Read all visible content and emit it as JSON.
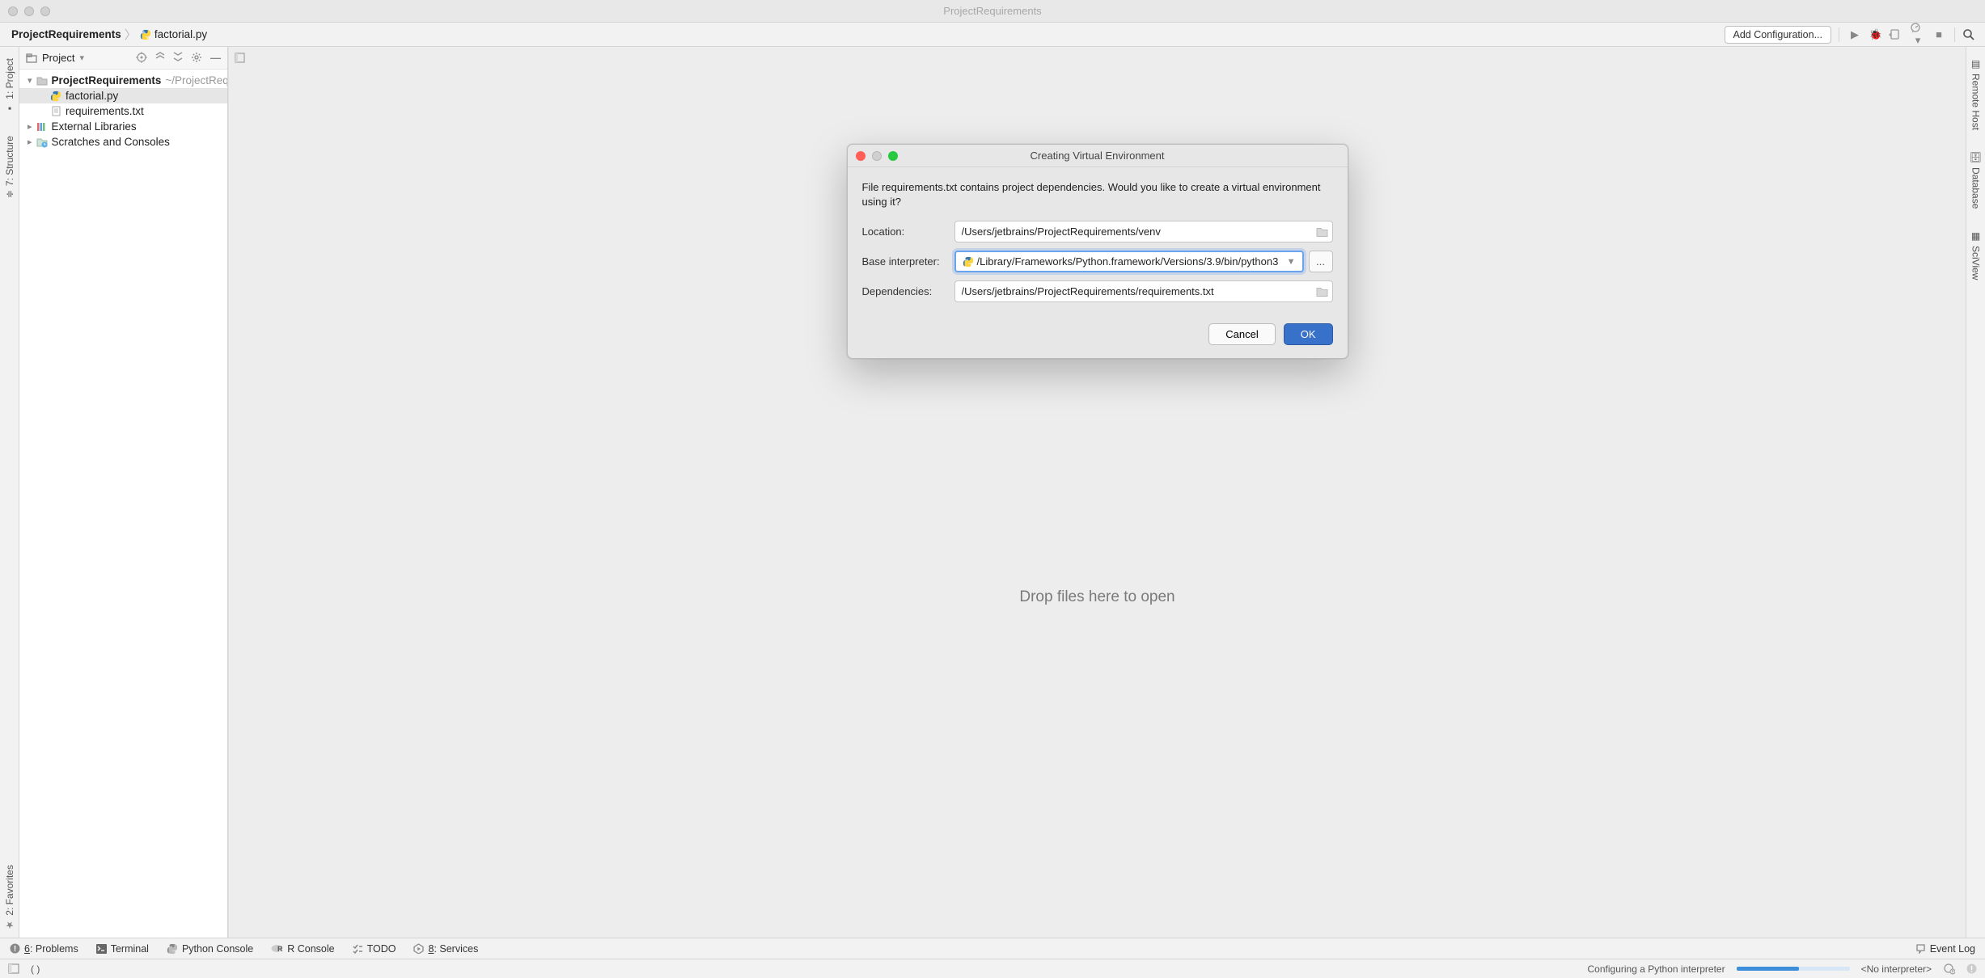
{
  "window": {
    "title": "ProjectRequirements"
  },
  "breadcrumb": {
    "root": "ProjectRequirements",
    "file": "factorial.py"
  },
  "toolbar": {
    "add_configuration": "Add Configuration..."
  },
  "left_rail": {
    "project": "1: Project",
    "structure": "7: Structure",
    "favorites": "2: Favorites"
  },
  "right_rail": {
    "remote_host": "Remote Host",
    "database": "Database",
    "sciview": "SciView"
  },
  "project_panel": {
    "header": "Project",
    "nodes": {
      "root": "ProjectRequirements",
      "root_path": "~/ProjectRequirements",
      "file1": "factorial.py",
      "file2": "requirements.txt",
      "ext_lib": "External Libraries",
      "scratches": "Scratches and Consoles"
    }
  },
  "editor": {
    "drop_hint": "Drop files here to open"
  },
  "dialog": {
    "title": "Creating Virtual Environment",
    "message": "File requirements.txt contains project dependencies. Would you like to create a virtual environment using it?",
    "fields": {
      "location_label": "Location:",
      "location_value": "/Users/jetbrains/ProjectRequirements/venv",
      "interpreter_label": "Base interpreter:",
      "interpreter_value": "/Library/Frameworks/Python.framework/Versions/3.9/bin/python3",
      "dependencies_label": "Dependencies:",
      "dependencies_value": "/Users/jetbrains/ProjectRequirements/requirements.txt"
    },
    "buttons": {
      "cancel": "Cancel",
      "ok": "OK",
      "browse": "..."
    }
  },
  "bottom_bar": {
    "problems": "6: Problems",
    "terminal": "Terminal",
    "py_console": "Python Console",
    "r_console": "R Console",
    "todo": "TODO",
    "services": "8: Services",
    "event_log": "Event Log"
  },
  "status": {
    "task": "Configuring a Python interpreter",
    "interpreter": "<No interpreter>"
  }
}
